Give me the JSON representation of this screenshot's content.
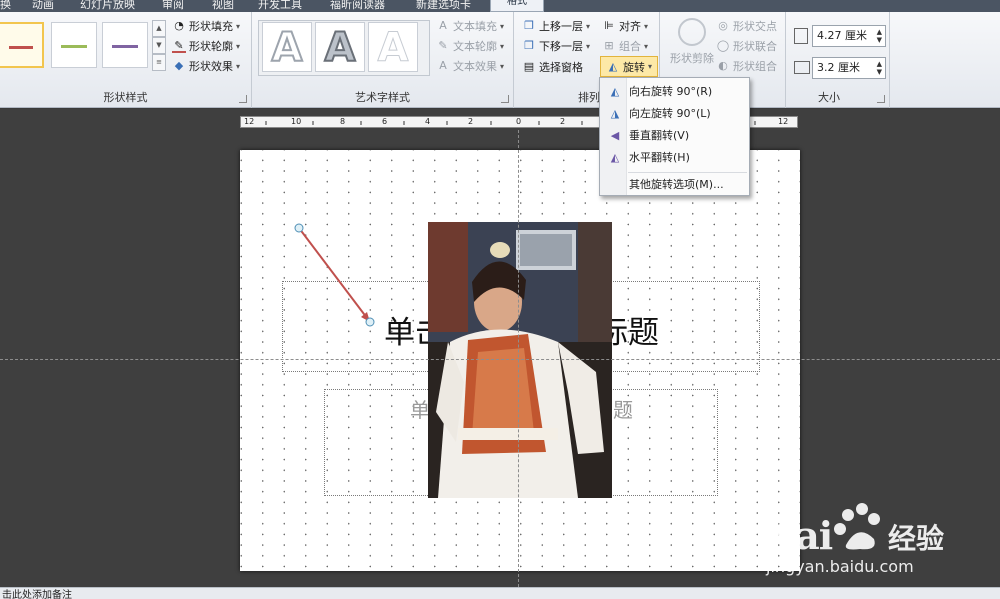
{
  "tabs": [
    {
      "label": "换"
    },
    {
      "label": "动画"
    },
    {
      "label": "幻灯片放映"
    },
    {
      "label": "审阅"
    },
    {
      "label": "视图"
    },
    {
      "label": "开发工具"
    },
    {
      "label": "福昕阅读器"
    },
    {
      "label": "新建选项卡"
    },
    {
      "label": "格式"
    }
  ],
  "ribbon": {
    "shape_styles": {
      "label": "形状样式",
      "fill": "形状填充",
      "outline": "形状轮廓",
      "effects": "形状效果",
      "swatch_colors": [
        "#c0504d",
        "#9bbb59",
        "#8064a2"
      ]
    },
    "wordart": {
      "label": "艺术字样式",
      "glyph": "A",
      "fill": "文本填充",
      "outline": "文本轮廓",
      "effects": "文本效果"
    },
    "arrange": {
      "label": "排列",
      "bring_forward": "上移一层",
      "send_backward": "下移一层",
      "selection_pane": "选择窗格",
      "align": "对齐",
      "group": "组合",
      "rotate": "旋转"
    },
    "shape_ops": {
      "union": "形状剪除",
      "intersect": "形状交点",
      "combine": "形状联合",
      "fragment": "形状组合"
    },
    "size": {
      "label": "大小",
      "height": "4.27 厘米",
      "width": "3.2 厘米"
    }
  },
  "rotate_menu": [
    {
      "label": "向右旋转 90°(R)",
      "icon": "rotate-right-icon"
    },
    {
      "label": "向左旋转 90°(L)",
      "icon": "rotate-left-icon"
    },
    {
      "label": "垂直翻转(V)",
      "icon": "flip-vertical-icon"
    },
    {
      "label": "水平翻转(H)",
      "icon": "flip-horizontal-icon"
    },
    {
      "label": "其他旋转选项(M)...",
      "icon": ""
    }
  ],
  "ruler": {
    "labels": [
      "12",
      "10",
      "8",
      "6",
      "4",
      "2",
      "0",
      "2",
      "4",
      "6",
      "8",
      "10",
      "12"
    ]
  },
  "slide": {
    "title_left": "单击",
    "title_right": "标题",
    "subtitle_left": "单",
    "subtitle_right": "题"
  },
  "status_bar": {
    "text": "击此处添加备注"
  },
  "watermark": {
    "brand": "Bai",
    "brand2": "du",
    "label": "经验",
    "url": "jingyan.baidu.com"
  },
  "colors": {
    "accent_rotate": "#fde9a7",
    "arrow": "#c0504d"
  }
}
